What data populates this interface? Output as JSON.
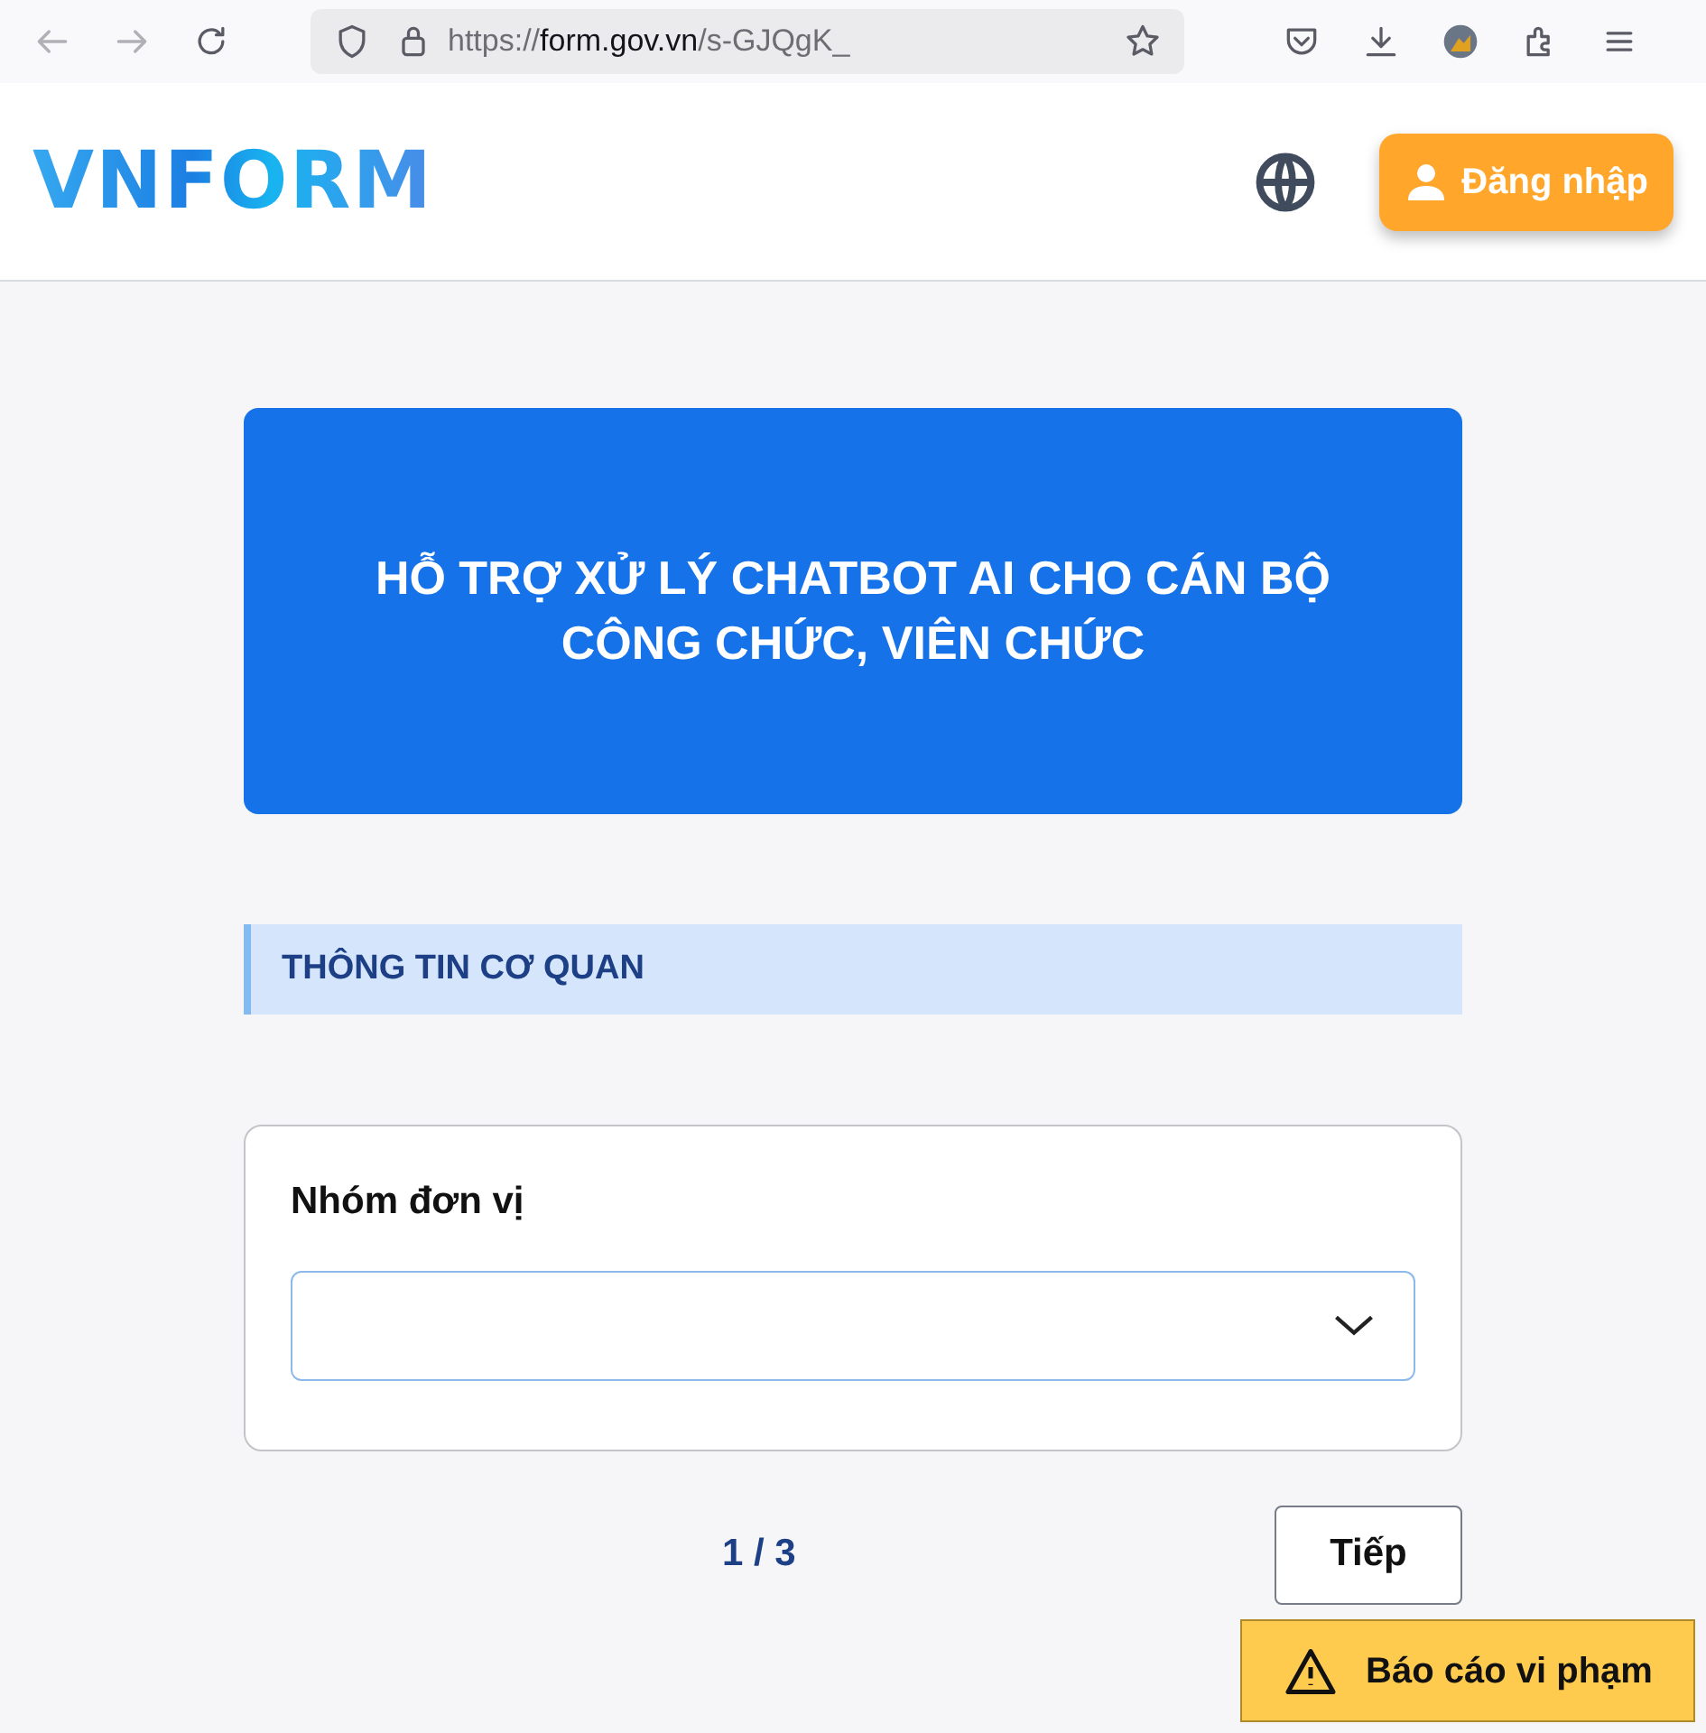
{
  "browser": {
    "url": {
      "scheme": "https://",
      "host": "form.gov.vn",
      "path": "/s-GJQgK_"
    }
  },
  "header": {
    "logo": "VNFORM",
    "login_button": "Đăng nhập"
  },
  "banner": {
    "title": "HỖ TRỢ XỬ LÝ CHATBOT AI CHO CÁN BỘ CÔNG CHỨC, VIÊN CHỨC"
  },
  "section": {
    "title": "THÔNG TIN CƠ QUAN"
  },
  "fields": [
    {
      "kind": "select",
      "label": "Nhóm đơn vị"
    }
  ],
  "pager": {
    "page": "1 / 3",
    "next_button": "Tiếp"
  },
  "report_button": "Báo cáo vi phạm"
}
